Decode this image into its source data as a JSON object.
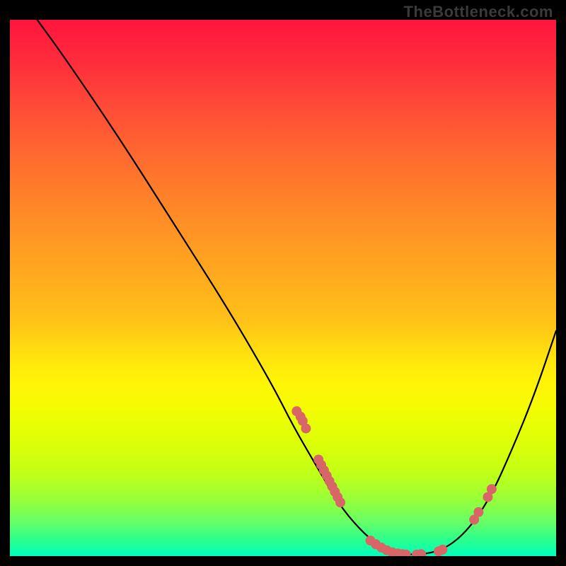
{
  "watermark": "TheBottleneck.com",
  "chart_data": {
    "type": "line",
    "title": "",
    "xlabel": "",
    "ylabel": "",
    "xlim": [
      0,
      100
    ],
    "ylim": [
      0,
      100
    ],
    "curve": [
      {
        "x": 5,
        "y": 100
      },
      {
        "x": 10,
        "y": 93
      },
      {
        "x": 20,
        "y": 78
      },
      {
        "x": 30,
        "y": 62
      },
      {
        "x": 40,
        "y": 46
      },
      {
        "x": 48,
        "y": 32
      },
      {
        "x": 52,
        "y": 24
      },
      {
        "x": 56,
        "y": 17
      },
      {
        "x": 60,
        "y": 10
      },
      {
        "x": 64,
        "y": 5
      },
      {
        "x": 68,
        "y": 1.5
      },
      {
        "x": 72,
        "y": 0.3
      },
      {
        "x": 76,
        "y": 0.3
      },
      {
        "x": 80,
        "y": 1.5
      },
      {
        "x": 84,
        "y": 5
      },
      {
        "x": 88,
        "y": 11
      },
      {
        "x": 92,
        "y": 20
      },
      {
        "x": 96,
        "y": 30
      },
      {
        "x": 100,
        "y": 42
      }
    ],
    "scatter_points": [
      {
        "x": 52.5,
        "y": 27
      },
      {
        "x": 53.2,
        "y": 26
      },
      {
        "x": 53.6,
        "y": 25.2
      },
      {
        "x": 54.2,
        "y": 23.8
      },
      {
        "x": 56.5,
        "y": 18
      },
      {
        "x": 57.0,
        "y": 17
      },
      {
        "x": 57.5,
        "y": 16
      },
      {
        "x": 58.0,
        "y": 15
      },
      {
        "x": 58.5,
        "y": 14
      },
      {
        "x": 59.0,
        "y": 13
      },
      {
        "x": 59.5,
        "y": 12
      },
      {
        "x": 60.0,
        "y": 11
      },
      {
        "x": 60.5,
        "y": 10
      },
      {
        "x": 66.0,
        "y": 2.9
      },
      {
        "x": 67.0,
        "y": 2.2
      },
      {
        "x": 68.0,
        "y": 1.6
      },
      {
        "x": 69.0,
        "y": 1.1
      },
      {
        "x": 70.0,
        "y": 0.7
      },
      {
        "x": 71.0,
        "y": 0.5
      },
      {
        "x": 71.8,
        "y": 0.35
      },
      {
        "x": 72.5,
        "y": 0.3
      },
      {
        "x": 74.5,
        "y": 0.3
      },
      {
        "x": 75.3,
        "y": 0.35
      },
      {
        "x": 78.5,
        "y": 0.9
      },
      {
        "x": 79.2,
        "y": 1.2
      },
      {
        "x": 85.0,
        "y": 6.8
      },
      {
        "x": 85.8,
        "y": 8.2
      },
      {
        "x": 87.5,
        "y": 11.0
      },
      {
        "x": 88.2,
        "y": 12.5
      }
    ],
    "point_color": "#d96666",
    "curve_color": "#000000"
  }
}
